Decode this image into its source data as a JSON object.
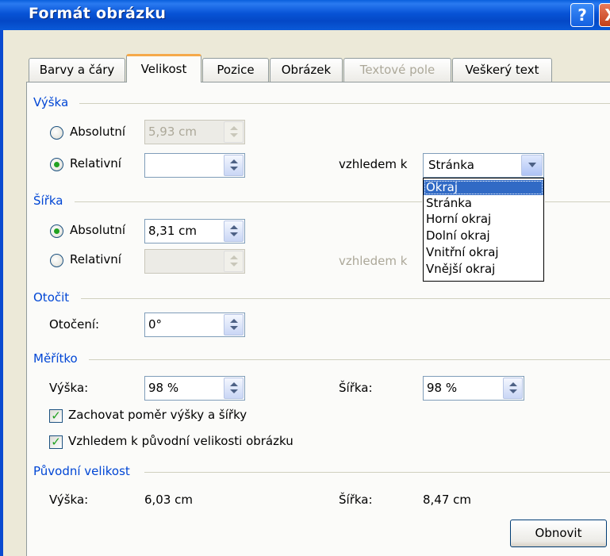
{
  "window": {
    "title": "Formát obrázku",
    "help_label": "?",
    "close_label": "X"
  },
  "tabs": [
    {
      "label": "Barvy a čáry",
      "active": false,
      "disabled": false
    },
    {
      "label": "Velikost",
      "active": true,
      "disabled": false
    },
    {
      "label": "Pozice",
      "active": false,
      "disabled": false
    },
    {
      "label": "Obrázek",
      "active": false,
      "disabled": false
    },
    {
      "label": "Textové pole",
      "active": false,
      "disabled": true
    },
    {
      "label": "Veškerý text",
      "active": false,
      "disabled": false
    }
  ],
  "height": {
    "section": "Výška",
    "absolute_label": "Absolutní",
    "absolute_value": "5,93 cm",
    "relative_label": "Relativní",
    "relative_value": "",
    "relative_to_label": "vzhledem k",
    "relative_to_value": "Stránka",
    "selected": "relative"
  },
  "dropdown": {
    "options": [
      "Okraj",
      "Stránka",
      "Horní okraj",
      "Dolní okraj",
      "Vnitřní okraj",
      "Vnější okraj"
    ],
    "highlighted": "Okraj"
  },
  "width": {
    "section": "Šířka",
    "absolute_label": "Absolutní",
    "absolute_value": "8,31 cm",
    "relative_label": "Relativní",
    "relative_value": "",
    "relative_to_label": "vzhledem k",
    "selected": "absolute"
  },
  "rotate": {
    "section": "Otočit",
    "rotation_label": "Otočení:",
    "rotation_value": "0°"
  },
  "scale": {
    "section": "Měřítko",
    "height_label": "Výška:",
    "height_value": "98 %",
    "width_label": "Šířka:",
    "width_value": "98 %",
    "lock_aspect_label": "Zachovat poměr výšky a šířky",
    "lock_aspect_checked": true,
    "relative_original_label": "Vzhledem k původní velikosti obrázku",
    "relative_original_checked": true
  },
  "original": {
    "section": "Původní velikost",
    "height_label": "Výška:",
    "height_value": "6,03 cm",
    "width_label": "Šířka:",
    "width_value": "8,47 cm",
    "reset_label": "Obnovit"
  }
}
